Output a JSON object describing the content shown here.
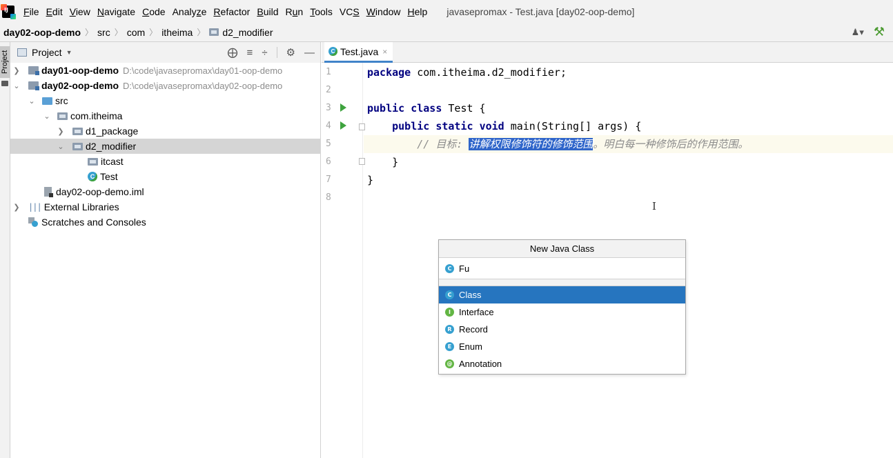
{
  "menu": {
    "items": [
      {
        "label": "File",
        "u": "F",
        "rest": "ile"
      },
      {
        "label": "Edit",
        "u": "E",
        "rest": "dit"
      },
      {
        "label": "View",
        "u": "V",
        "rest": "iew"
      },
      {
        "label": "Navigate",
        "u": "N",
        "rest": "avigate"
      },
      {
        "label": "Code",
        "u": "C",
        "rest": "ode"
      },
      {
        "label": "Analyze",
        "pre": "Analy",
        "u": "z",
        "rest": "e"
      },
      {
        "label": "Refactor",
        "u": "R",
        "rest": "efactor"
      },
      {
        "label": "Build",
        "u": "B",
        "rest": "uild"
      },
      {
        "label": "Run",
        "pre": "R",
        "u": "u",
        "rest": "n"
      },
      {
        "label": "Tools",
        "u": "T",
        "rest": "ools"
      },
      {
        "label": "VCS",
        "pre": "VC",
        "u": "S",
        "rest": ""
      },
      {
        "label": "Window",
        "u": "W",
        "rest": "indow"
      },
      {
        "label": "Help",
        "u": "H",
        "rest": "elp"
      }
    ],
    "window_title": "javasepromax - Test.java [day02-oop-demo]"
  },
  "breadcrumb": {
    "items": [
      "day02-oop-demo",
      "src",
      "com",
      "itheima",
      "d2_modifier"
    ]
  },
  "side_strip": {
    "project_tab": "Project"
  },
  "project_panel": {
    "title": "Project",
    "tree": [
      {
        "label": "day01-oop-demo",
        "path": "D:\\code\\javasepromax\\day01-oop-demo"
      },
      {
        "label": "day02-oop-demo",
        "path": "D:\\code\\javasepromax\\day02-oop-demo"
      },
      {
        "label": "src"
      },
      {
        "label": "com.itheima"
      },
      {
        "label": "d1_package"
      },
      {
        "label": "d2_modifier"
      },
      {
        "label": "itcast"
      },
      {
        "label": "Test"
      },
      {
        "label": "day02-oop-demo.iml"
      },
      {
        "label": "External Libraries"
      },
      {
        "label": "Scratches and Consoles"
      }
    ]
  },
  "editor": {
    "tab": {
      "label": "Test.java",
      "close": "×"
    },
    "line_numbers": [
      "1",
      "2",
      "3",
      "4",
      "5",
      "6",
      "7",
      "8"
    ],
    "code": {
      "l1": {
        "kw": "package",
        "text": " com.itheima.d2_modifier;"
      },
      "l3": {
        "kw1": "public",
        "kw2": "class",
        "text": " Test {"
      },
      "l4": {
        "indent": "    ",
        "kw1": "public",
        "kw2": "static",
        "kw3": "void",
        "text": " main(String[] args) {"
      },
      "l5": {
        "indent": "        ",
        "prefix": "// 目标: ",
        "selected": "讲解权限修饰符的修饰范围",
        "suffix": "。明白每一种修饰后的作用范围。"
      },
      "l6": {
        "text": "    }"
      },
      "l7": {
        "text": "}"
      }
    }
  },
  "popup": {
    "title": "New Java Class",
    "input_value": "Fu",
    "items": [
      {
        "label": "Class",
        "letter": "C"
      },
      {
        "label": "Interface",
        "letter": "I"
      },
      {
        "label": "Record",
        "letter": "R"
      },
      {
        "label": "Enum",
        "letter": "E"
      },
      {
        "label": "Annotation",
        "letter": "@"
      }
    ]
  },
  "colors": {
    "accent": "#2675bf",
    "selection": "#2f65ca",
    "keyword": "#000080",
    "comment": "#8c8c8c",
    "run_icon": "#3ea33e"
  }
}
